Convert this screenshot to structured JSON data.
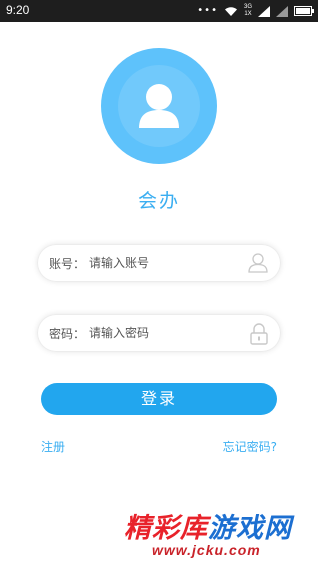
{
  "status_bar": {
    "time": "9:20",
    "dots": "•••",
    "network_top": "3G",
    "network_bottom": "1X",
    "icons": [
      "wifi-icon",
      "signal-icon",
      "signal-icon",
      "battery-icon"
    ]
  },
  "app": {
    "name": "会办",
    "avatar_icon": "user-icon",
    "accent_color": "#3aaef1"
  },
  "form": {
    "account": {
      "label": "账号：",
      "placeholder": "请输入账号",
      "value": "",
      "icon": "user-outline-icon"
    },
    "password": {
      "label": "密码：",
      "placeholder": "请输入密码",
      "value": "",
      "icon": "lock-icon"
    },
    "login_label": "登录",
    "register_label": "注册",
    "forgot_label": "忘记密码?"
  },
  "watermark": {
    "part1": "精彩库",
    "part2": "游戏网",
    "url": "www.jcku.com"
  }
}
